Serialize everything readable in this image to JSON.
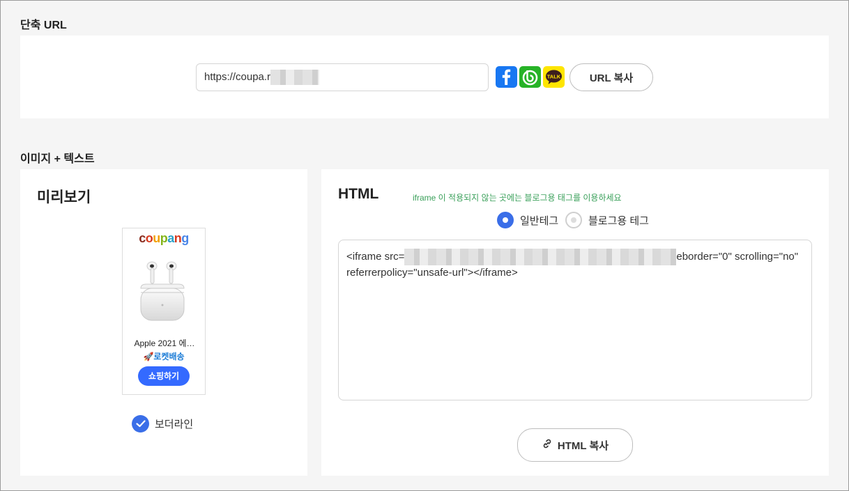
{
  "short_url": {
    "title": "단축 URL",
    "url_visible": "https://coupa.r",
    "share_icons": [
      "facebook-icon",
      "band-icon",
      "kakaotalk-icon"
    ],
    "talk_label": "TALK",
    "copy_label": "URL 복사"
  },
  "image_text": {
    "title": "이미지 + 텍스트",
    "preview": {
      "heading": "미리보기",
      "ad": {
        "logo": "coupang",
        "product_name": "Apple 2021 에…",
        "rocket": "🚀로켓배송",
        "shop_button": "쇼핑하기"
      },
      "border_label": "보더라인",
      "border_checked": true
    },
    "html": {
      "heading": "HTML",
      "hint": "iframe 이 적용되지 않는 곳에는 블로그용 태그를 이용하세요",
      "radio_general": "일반테그",
      "radio_blog": "블로그용 테그",
      "selected": "일반테그",
      "code_prefix": "<iframe src=",
      "code_suffix": "eborder=\"0\" scrolling=\"no\" referrerpolicy=\"unsafe-url\"></iframe>",
      "copy_label": "HTML 복사"
    }
  },
  "colors": {
    "accent": "#3a6ee8",
    "coupang_button": "#346aff",
    "hint": "#3aa05a"
  }
}
